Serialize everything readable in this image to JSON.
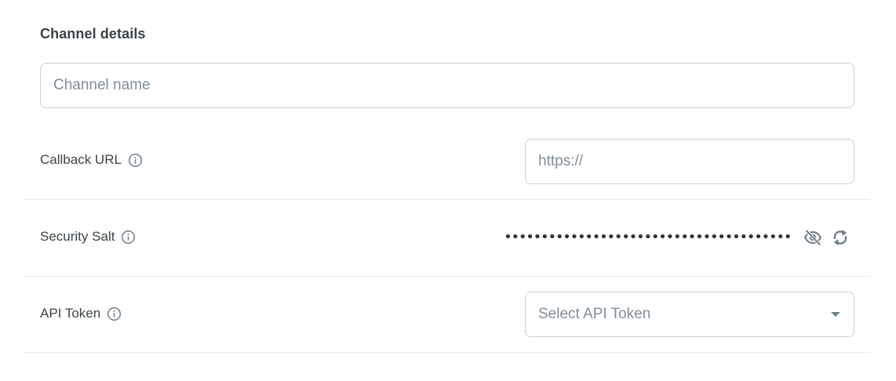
{
  "section": {
    "title": "Channel details"
  },
  "channel_name": {
    "placeholder": "Channel name",
    "value": ""
  },
  "callback_url": {
    "label": "Callback URL",
    "placeholder": "https://",
    "value": ""
  },
  "security_salt": {
    "label": "Security Salt",
    "masked_value": "••••••••••••••••••••••••••••••••••••••••••••••••••",
    "visibility_icon": "eye-off-icon",
    "regenerate_icon": "refresh-icon"
  },
  "api_token": {
    "label": "API Token",
    "placeholder": "Select API Token"
  },
  "colors": {
    "border": "#c9cfd3",
    "placeholder": "#7d8f99",
    "icon": "#6e7f88",
    "text": "#3b4449"
  }
}
